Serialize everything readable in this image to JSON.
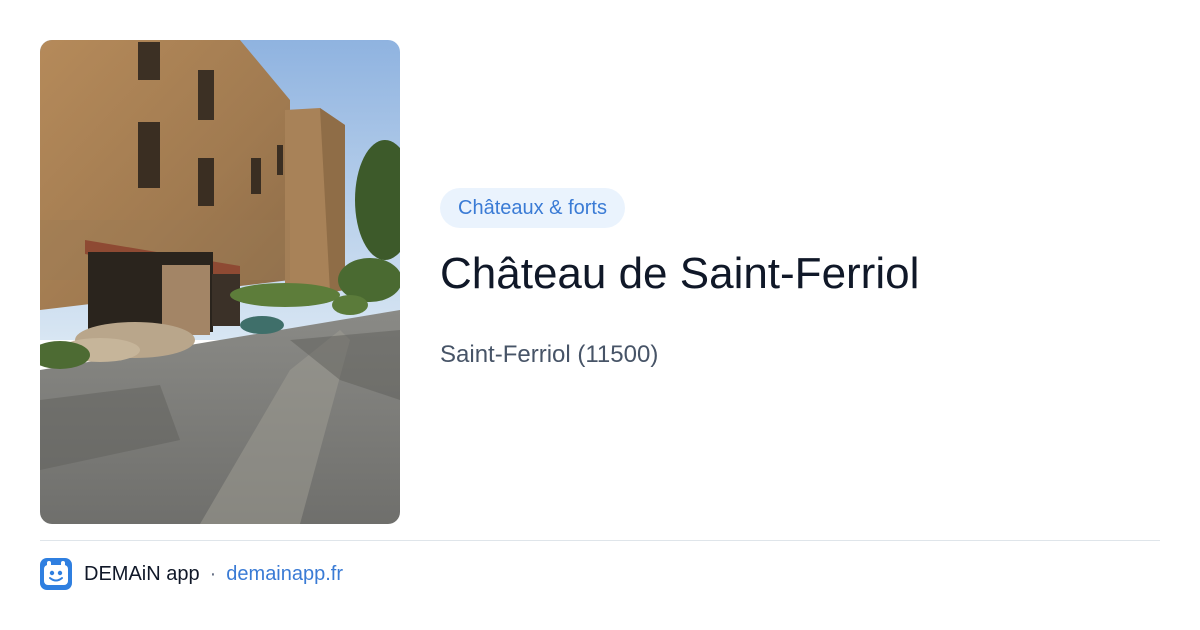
{
  "card": {
    "image_alt": "Château de Saint-Ferriol",
    "category": "Châteaux & forts",
    "title": "Château de Saint-Ferriol",
    "location": "Saint-Ferriol (11500)"
  },
  "footer": {
    "app_name": "DEMAiN app",
    "separator": "·",
    "site": "demainapp.fr"
  },
  "colors": {
    "accent": "#3a7bd5",
    "tag_background": "#eaf3fd",
    "title": "#101828",
    "muted": "#475467",
    "divider": "#dfe5ea"
  },
  "icons": {
    "app_logo": "demain-app-logo-icon"
  }
}
